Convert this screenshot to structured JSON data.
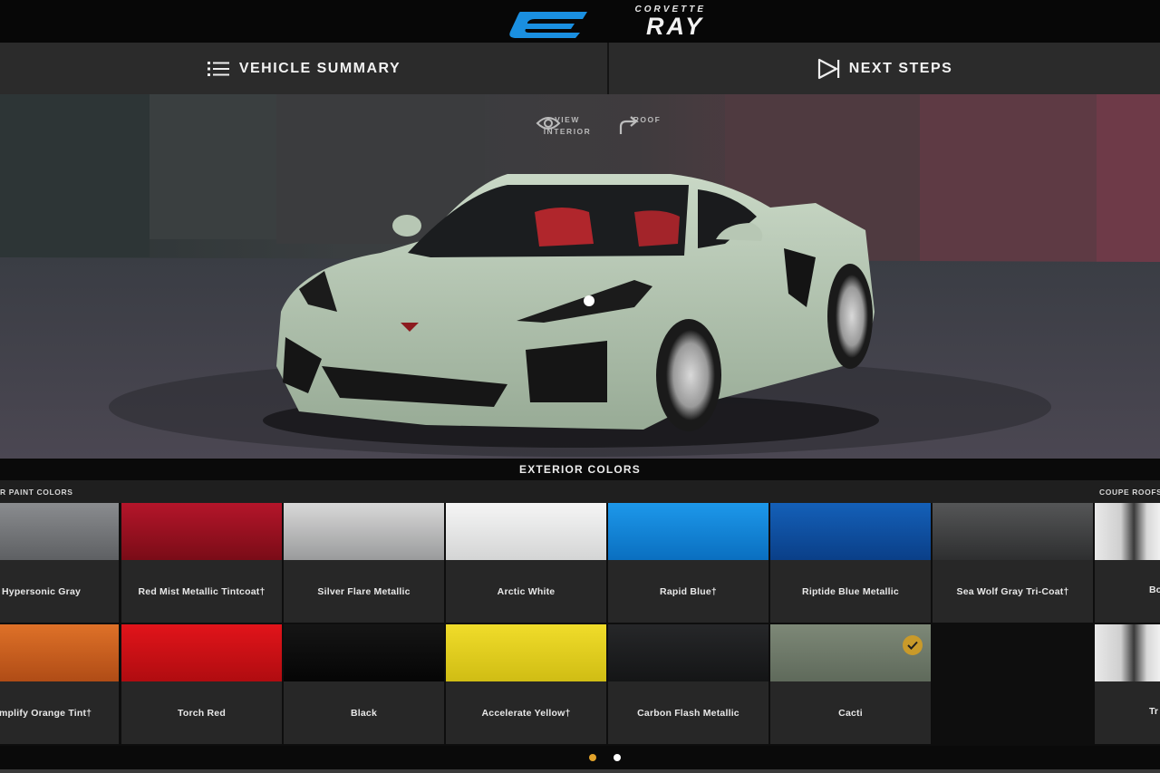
{
  "header": {
    "brand_text": "CORVETTE",
    "model_text": "RAY",
    "logo_color": "#1a8fe0"
  },
  "nav": {
    "summary_label": "VEHICLE SUMMARY",
    "next_label": "NEXT STEPS",
    "summary_icon": "list-icon",
    "next_icon": "play-icon"
  },
  "viewer": {
    "view_interior_line1": "VIEW",
    "view_interior_line2": "INTERIOR",
    "roof_label": "ROOF",
    "view_icon": "eye-icon",
    "roof_icon": "rotate-arrow-icon"
  },
  "exterior": {
    "title": "EXTERIOR COLORS",
    "section_left": "R PAINT COLORS",
    "section_right": "COUPE ROOFS",
    "selected_color": "Cacti",
    "accent_color": "#c99a2a"
  },
  "colors": [
    {
      "name": "Hypersonic Gray",
      "hex": "#6d6f72"
    },
    {
      "name": "Red Mist Metallic Tintcoat†",
      "hex": "#8e0f1c"
    },
    {
      "name": "Silver Flare Metallic",
      "hex": "#b9babb"
    },
    {
      "name": "Arctic White",
      "hex": "#e9eaea"
    },
    {
      "name": "Rapid Blue†",
      "hex": "#0b84d9"
    },
    {
      "name": "Riptide Blue Metallic",
      "hex": "#0c4ea4"
    },
    {
      "name": "Sea Wolf Gray Tri-Coat†",
      "hex": "#3f3f40"
    },
    {
      "name": "mplify Orange Tint†",
      "hex": "#cf5f1f"
    },
    {
      "name": "Torch Red",
      "hex": "#d40f12"
    },
    {
      "name": "Black",
      "hex": "#0b0b0b"
    },
    {
      "name": "Accelerate Yellow†",
      "hex": "#e8d41e"
    },
    {
      "name": "Carbon Flash Metallic",
      "hex": "#1b1c1e"
    },
    {
      "name": "Cacti",
      "hex": "#6f7a6a"
    }
  ],
  "roofs": [
    {
      "name": "Bo"
    },
    {
      "name": "Tr"
    }
  ],
  "pager": {
    "active_color": "#e2a32b",
    "inactive_color": "#ffffff"
  }
}
